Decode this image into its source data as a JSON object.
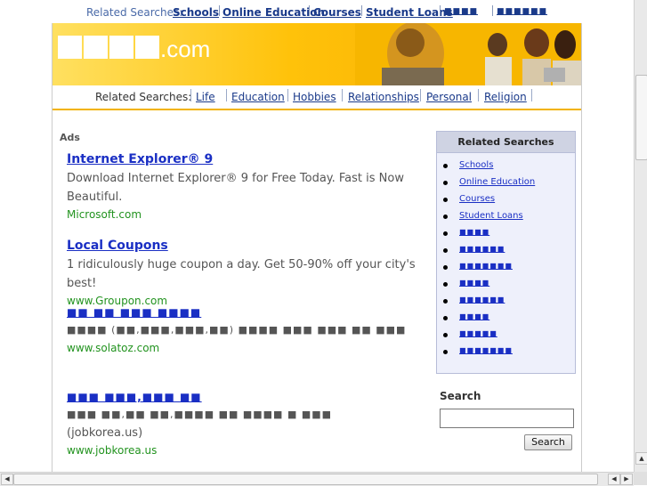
{
  "top_related": {
    "label": "Related Searches:",
    "links": [
      "Schools",
      "Online Education",
      "Courses",
      "Student Loans",
      "■■■■",
      "■■■■■■"
    ]
  },
  "banner": {
    "logo_blocks": "■■■■",
    "logo_suffix": ".com"
  },
  "nav": {
    "label": "Related Searches:",
    "links": [
      "Life",
      "Education",
      "Hobbies",
      "Relationships",
      "Personal",
      "Religion"
    ]
  },
  "ads": {
    "label": "Ads",
    "items": [
      {
        "title": "Internet Explorer® 9",
        "desc": "Download Internet Explorer® 9 for Free Today. Fast is Now Beautiful.",
        "url": "Microsoft.com"
      },
      {
        "title": "Local Coupons",
        "desc": "1 ridiculously huge coupon a day. Get 50-90% off your city's best!",
        "url": "www.Groupon.com"
      },
      {
        "title": "■■ ■■ ■■■ ■■■■",
        "desc": "■■■■ (■■,■■■,■■■,■■) ■■■■ ■■■ ■■■ ■■ ■■■",
        "url": "www.solatoz.com"
      },
      {
        "title": "■■■ ■■■,■■■ ■■",
        "desc": "■■■ ■■,■■ ■■,■■■■ ■■ ■■■■ ■ ■■■",
        "desc2": "(jobkorea.us)",
        "url": "www.jobkorea.us"
      }
    ]
  },
  "sidebar": {
    "header": "Related Searches",
    "items": [
      "Schools",
      "Online Education",
      "Courses",
      "Student Loans",
      "■■■■",
      "■■■■■■",
      "■■■■■■■",
      "■■■■",
      "■■■■■■",
      "■■■■",
      "■■■■■",
      "■■■■■■■"
    ]
  },
  "search": {
    "label": "Search",
    "button": "Search",
    "value": ""
  },
  "colors": {
    "banner": "#ffc20a",
    "link": "#1a2fc4",
    "ad_url": "#22931f"
  }
}
